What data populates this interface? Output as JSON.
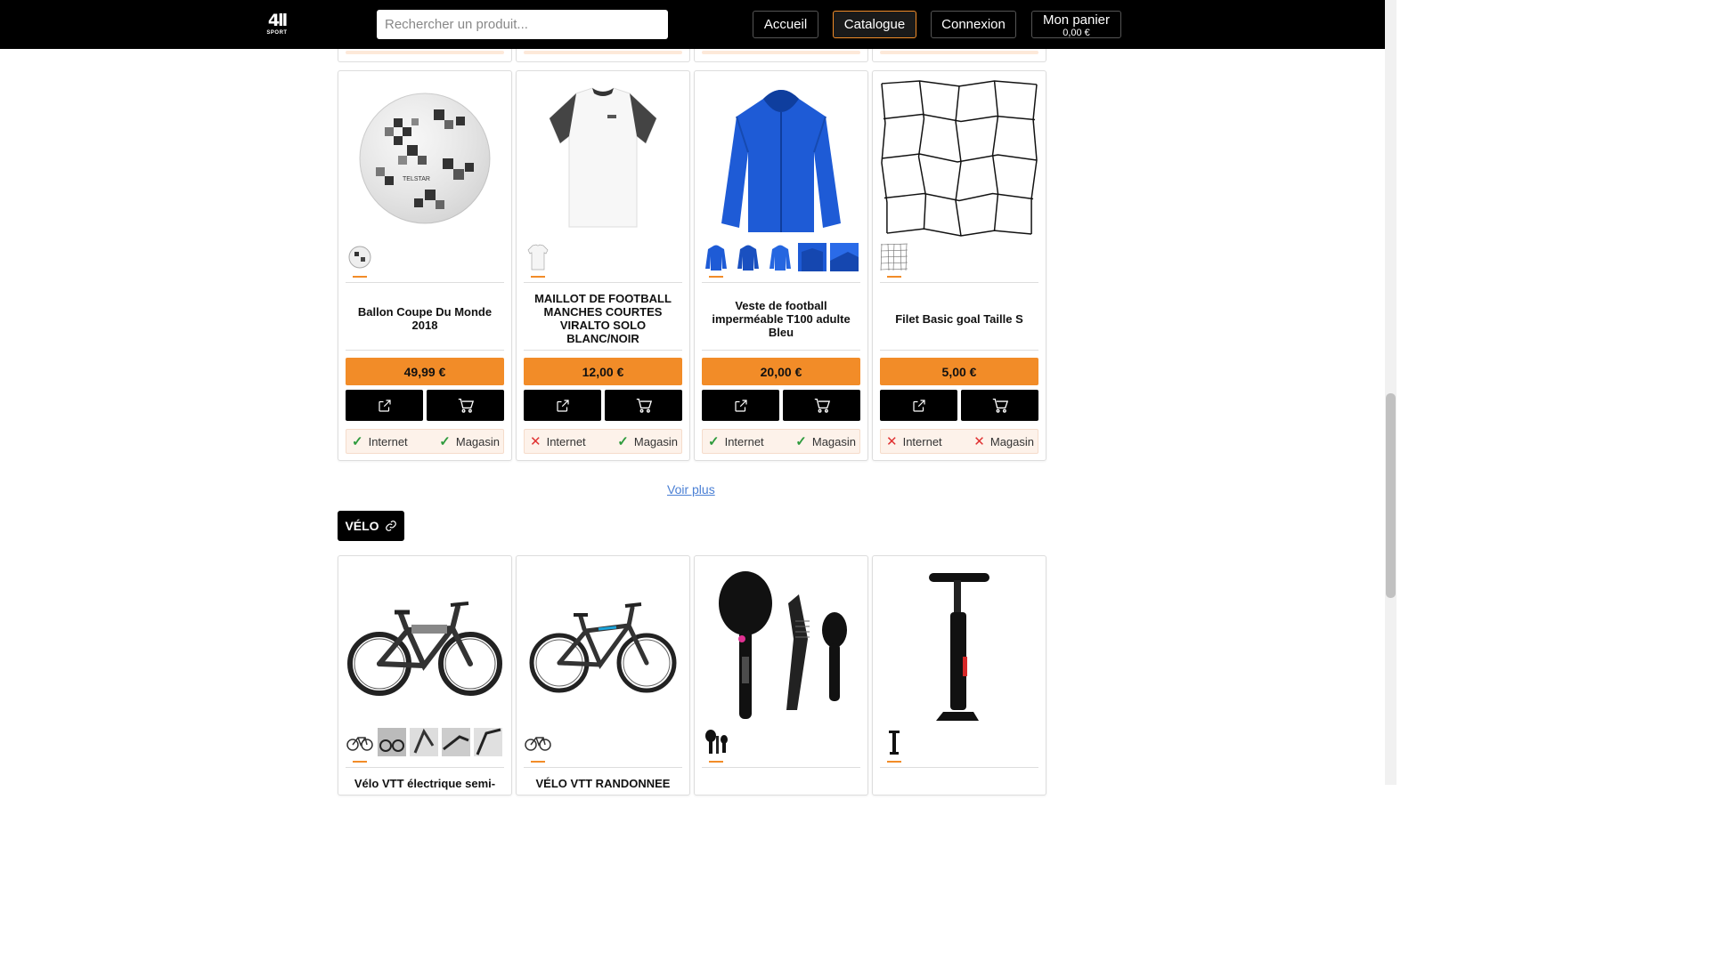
{
  "header": {
    "logo_big": "4ll",
    "logo_small": "SPORT",
    "search_placeholder": "Rechercher un produit...",
    "nav": {
      "accueil": "Accueil",
      "catalogue": "Catalogue",
      "connexion": "Connexion",
      "panier_label": "Mon panier",
      "panier_amount": "0,00 €"
    },
    "active_nav": "Catalogue"
  },
  "colors": {
    "accent": "#f28c28",
    "header_bg": "#000000",
    "ok": "#2e9b3d",
    "ko": "#e03131",
    "link": "#4a7fd4"
  },
  "football_products": [
    {
      "title": "Ballon Coupe Du Monde 2018",
      "price": "49,99 €",
      "internet_label": "Internet",
      "internet_available": true,
      "magasin_label": "Magasin",
      "magasin_available": true,
      "thumb_count": 1
    },
    {
      "title": "MAILLOT DE FOOTBALL MANCHES COURTES VIRALTO SOLO BLANC/NOIR",
      "price": "12,00 €",
      "internet_label": "Internet",
      "internet_available": false,
      "magasin_label": "Magasin",
      "magasin_available": true,
      "thumb_count": 1
    },
    {
      "title": "Veste de football imperméable T100 adulte Bleu",
      "price": "20,00 €",
      "internet_label": "Internet",
      "internet_available": true,
      "magasin_label": "Magasin",
      "magasin_available": true,
      "thumb_count": 5
    },
    {
      "title": "Filet Basic goal Taille S",
      "price": "5,00 €",
      "internet_label": "Internet",
      "internet_available": false,
      "magasin_label": "Magasin",
      "magasin_available": false,
      "thumb_count": 1
    }
  ],
  "voir_plus": "Voir plus",
  "category": {
    "label": "VÉLO"
  },
  "velo_products": [
    {
      "title": "Vélo VTT électrique semi-",
      "thumb_count": 5
    },
    {
      "title": "VÉLO VTT RANDONNEE",
      "thumb_count": 1
    },
    {
      "title": "",
      "thumb_count": 1
    },
    {
      "title": "",
      "thumb_count": 1
    }
  ]
}
